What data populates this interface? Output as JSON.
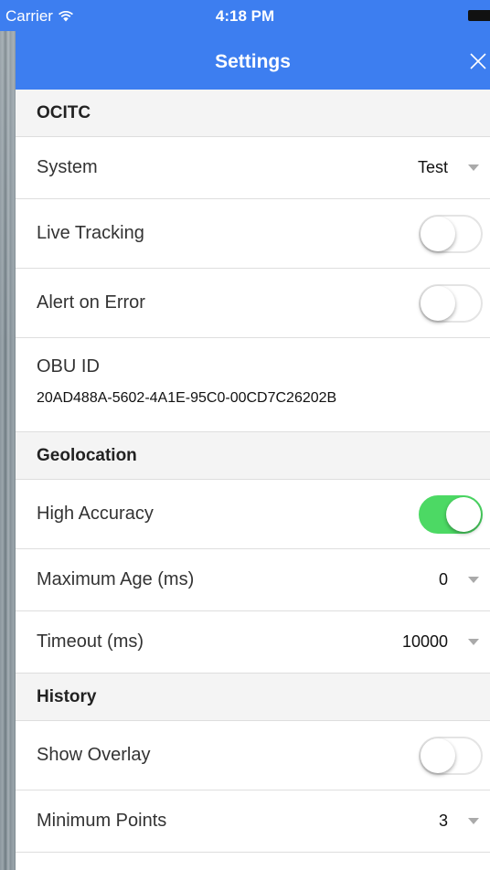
{
  "status_bar": {
    "carrier": "Carrier",
    "time": "4:18 PM",
    "wifi_icon": "wifi-icon",
    "battery_icon": "battery-icon"
  },
  "nav": {
    "title": "Settings",
    "close_icon": "close-icon",
    "bar_color": "#3d7ef0"
  },
  "sections": {
    "ocitc": {
      "header": "OCITC",
      "system": {
        "label": "System",
        "value": "Test"
      },
      "live_tracking": {
        "label": "Live Tracking",
        "on": false
      },
      "alert_on_error": {
        "label": "Alert on Error",
        "on": false
      },
      "obu_id": {
        "label": "OBU ID",
        "value": "20AD488A-5602-4A1E-95C0-00CD7C26202B"
      }
    },
    "geolocation": {
      "header": "Geolocation",
      "high_accuracy": {
        "label": "High Accuracy",
        "on": true
      },
      "maximum_age": {
        "label": "Maximum Age (ms)",
        "value": "0"
      },
      "timeout": {
        "label": "Timeout (ms)",
        "value": "10000"
      }
    },
    "history": {
      "header": "History",
      "show_overlay": {
        "label": "Show Overlay",
        "on": false
      },
      "minimum_points": {
        "label": "Minimum Points",
        "value": "3"
      }
    }
  },
  "colors": {
    "toggle_on": "#4cd964",
    "header_bg": "#f4f4f4"
  }
}
